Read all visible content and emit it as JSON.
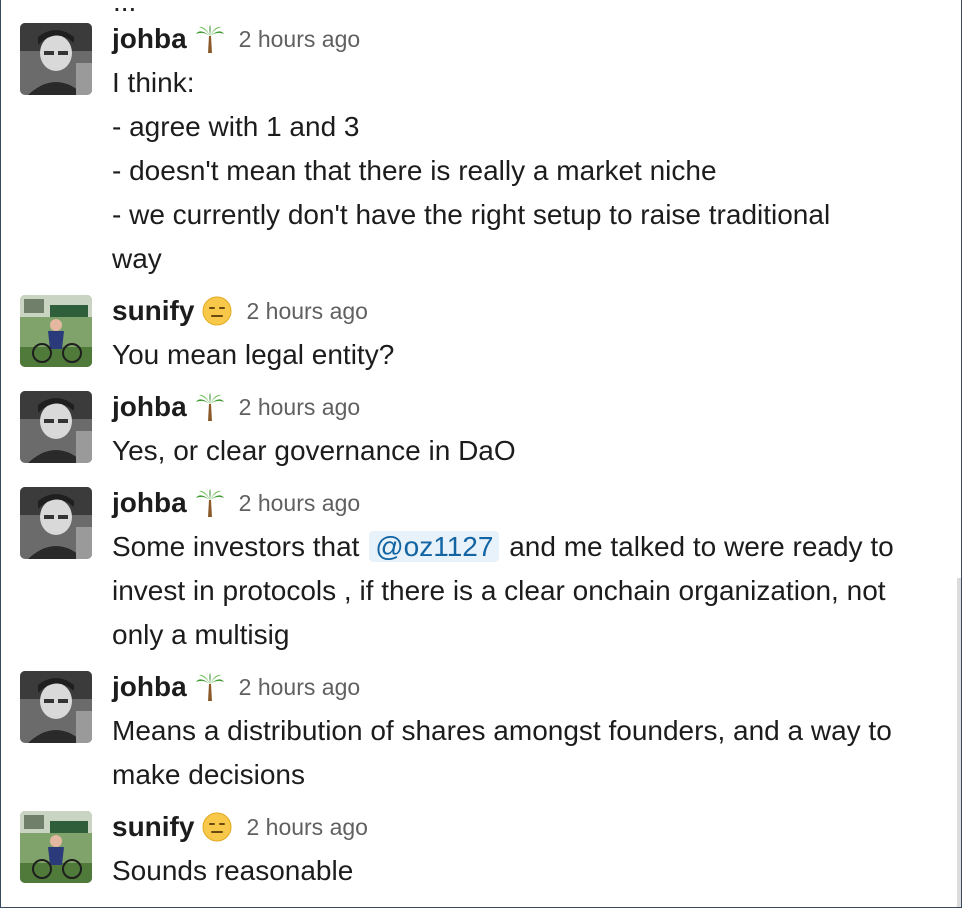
{
  "top_clipped": "...",
  "messages": [
    {
      "user": "johba",
      "status_emoji": "palm-tree-icon",
      "time": "2 hours ago",
      "lines": [
        "I think:",
        "- agree with 1 and 3",
        "- doesn't mean that there is really a market niche",
        "- we currently don't have the right setup to raise traditional",
        "way"
      ]
    },
    {
      "user": "sunify",
      "status_emoji": "expressionless-face-icon",
      "time": "2 hours ago",
      "lines": [
        "You mean legal entity?"
      ]
    },
    {
      "user": "johba",
      "status_emoji": "palm-tree-icon",
      "time": "2 hours ago",
      "lines": [
        "Yes, or clear governance in DaO"
      ]
    },
    {
      "user": "johba",
      "status_emoji": "palm-tree-icon",
      "time": "2 hours ago",
      "line1_before": "Some investors that",
      "mention": "@oz1127",
      "line1_after": "and me talked to were ready to",
      "lines_rest": [
        "invest in protocols , if there is a clear onchain organization, not",
        "only a multisig"
      ]
    },
    {
      "user": "johba",
      "status_emoji": "palm-tree-icon",
      "time": "2 hours ago",
      "lines": [
        "Means a distribution of shares amongst founders, and a way to",
        "make decisions"
      ]
    },
    {
      "user": "sunify",
      "status_emoji": "expressionless-face-icon",
      "time": "2 hours ago",
      "lines": [
        "Sounds reasonable"
      ]
    }
  ],
  "colors": {
    "text": "#1d1c1d",
    "timestamp": "#616061",
    "mention_text": "#1264a3",
    "mention_bg": "#e8f2fa"
  }
}
